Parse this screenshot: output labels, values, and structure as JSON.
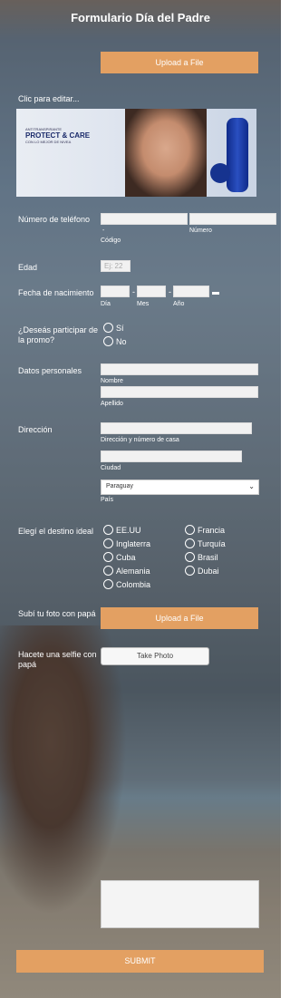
{
  "form": {
    "title": "Formulario Día del Padre",
    "upload_top_label": "Upload a File",
    "click_to_edit": "Clic para editar...",
    "ad": {
      "tag": "ANTITRANSPIRANTE",
      "headline": "PROTECT & CARE",
      "subline": "CON LO MEJOR DE NIVEA"
    },
    "phone": {
      "label": "Número de teléfono",
      "dash": "-",
      "code_label": "Código",
      "number_label": "Número"
    },
    "age": {
      "label": "Edad",
      "placeholder": "Ej: 22"
    },
    "birth": {
      "label": "Fecha de nacimiento",
      "day": "Día",
      "month": "Mes",
      "year": "Año",
      "sep": "-"
    },
    "promo": {
      "label": "¿Deseás participar de la promo?",
      "options": [
        "Sí",
        "No"
      ]
    },
    "personal": {
      "label": "Datos personales",
      "first": "Nombre",
      "last": "Apellido"
    },
    "address": {
      "label": "Dirección",
      "street": "Dirección y número de casa",
      "city": "Ciudad",
      "country_value": "Paraguay",
      "country": "País"
    },
    "destination": {
      "label": "Elegí el destino ideal",
      "col1": [
        "EE.UU",
        "Inglaterra",
        "Cuba",
        "Alemania",
        "Colombia"
      ],
      "col2": [
        "Francia",
        "Turquía",
        "Brasil",
        "Dubai"
      ]
    },
    "photo": {
      "label": "Subí tu foto con papá",
      "button": "Upload a File"
    },
    "selfie": {
      "label": "Hacete una selfie con papá",
      "button": "Take Photo"
    },
    "submit": "SUBMIT"
  }
}
